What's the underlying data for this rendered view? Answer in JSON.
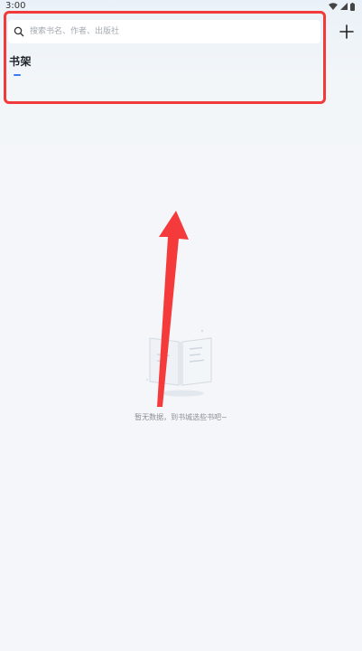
{
  "status_bar": {
    "time": "3:00"
  },
  "search": {
    "placeholder": "搜索书名、作者、出版社",
    "icon": "search-icon"
  },
  "header": {
    "add_icon": "plus-icon"
  },
  "shelf": {
    "title": "书架"
  },
  "empty_state": {
    "message": "暂无数据，到书城选些书吧~"
  },
  "colors": {
    "accent": "#3b7bf6",
    "highlight": "#f23a3a"
  }
}
